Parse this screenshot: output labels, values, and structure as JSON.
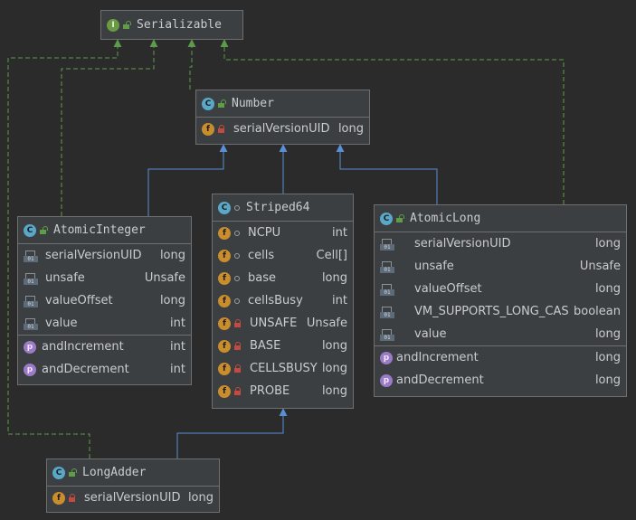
{
  "diagram": {
    "serializable": {
      "name": "Serializable",
      "kind_icon": "interface-icon"
    },
    "number": {
      "name": "Number",
      "kind_icon": "class-icon",
      "fields": [
        {
          "name": "serialVersionUID",
          "type": "long"
        }
      ]
    },
    "atomic_integer": {
      "name": "AtomicInteger",
      "kind_icon": "class-icon",
      "fields": [
        {
          "name": "serialVersionUID",
          "type": "long"
        },
        {
          "name": "unsafe",
          "type": "Unsafe"
        },
        {
          "name": "valueOffset",
          "type": "long"
        },
        {
          "name": "value",
          "type": "int"
        }
      ],
      "properties": [
        {
          "name": "andIncrement",
          "type": "int"
        },
        {
          "name": "andDecrement",
          "type": "int"
        }
      ]
    },
    "striped64": {
      "name": "Striped64",
      "kind_icon": "abstract-class-icon",
      "fields": [
        {
          "name": "NCPU",
          "type": "int"
        },
        {
          "name": "cells",
          "type": "Cell[]"
        },
        {
          "name": "base",
          "type": "long"
        },
        {
          "name": "cellsBusy",
          "type": "int"
        },
        {
          "name": "UNSAFE",
          "type": "Unsafe"
        },
        {
          "name": "BASE",
          "type": "long"
        },
        {
          "name": "CELLSBUSY",
          "type": "long"
        },
        {
          "name": "PROBE",
          "type": "long"
        }
      ]
    },
    "atomic_long": {
      "name": "AtomicLong",
      "kind_icon": "class-icon",
      "fields": [
        {
          "name": "serialVersionUID",
          "type": "long"
        },
        {
          "name": "unsafe",
          "type": "Unsafe"
        },
        {
          "name": "valueOffset",
          "type": "long"
        },
        {
          "name": "VM_SUPPORTS_LONG_CAS",
          "type": "boolean"
        },
        {
          "name": "value",
          "type": "long"
        }
      ],
      "properties": [
        {
          "name": "andIncrement",
          "type": "long"
        },
        {
          "name": "andDecrement",
          "type": "long"
        }
      ]
    },
    "long_adder": {
      "name": "LongAdder",
      "kind_icon": "class-icon",
      "fields": [
        {
          "name": "serialVersionUID",
          "type": "long"
        }
      ]
    },
    "icons": {
      "binary_field": "01",
      "interface": "I",
      "class": "C",
      "field": "f",
      "property": "p"
    },
    "colors": {
      "background": "#2b2b2b",
      "node_fill": "#3c3f41",
      "inheritance_edge": "#5a8fd6",
      "implementation_edge": "#5b9b4a"
    }
  }
}
